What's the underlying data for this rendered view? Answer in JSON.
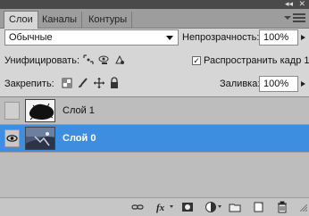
{
  "panel": {
    "tabs": [
      {
        "label": "Слои",
        "active": true
      },
      {
        "label": "Каналы",
        "active": false
      },
      {
        "label": "Контуры",
        "active": false
      }
    ]
  },
  "blend": {
    "mode_value": "Обычные",
    "opacity_label": "Непрозрачность:",
    "opacity_value": "100%"
  },
  "unify": {
    "label": "Унифицировать:",
    "propagate_label": "Распространить кадр 1",
    "propagate_checked": true
  },
  "lock": {
    "label": "Закрепить:",
    "fill_label": "Заливка:",
    "fill_value": "100%"
  },
  "layers": [
    {
      "name": "Слой 1",
      "visible": false,
      "selected": false
    },
    {
      "name": "Слой 0",
      "visible": true,
      "selected": true
    }
  ],
  "bottom_icons": [
    "link-icon",
    "fx-icon",
    "mask-icon",
    "adjustment-icon",
    "group-icon",
    "new-layer-icon",
    "trash-icon"
  ],
  "colors": {
    "selection": "#3d8ee0",
    "panel_bg": "#d6d6d6",
    "tabstrip": "#9d9d9d"
  }
}
